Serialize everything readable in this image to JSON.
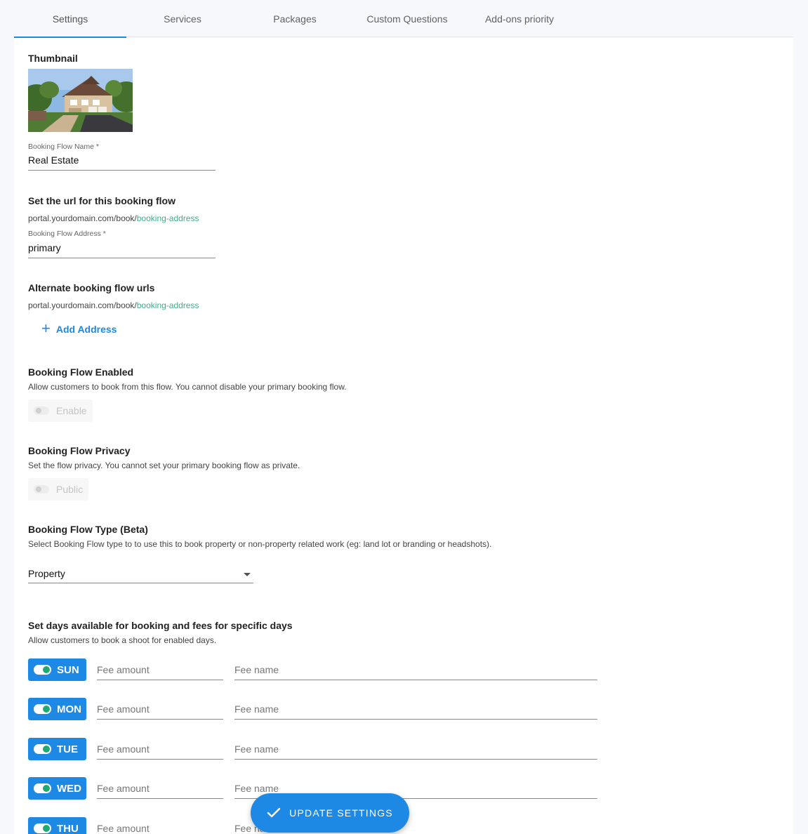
{
  "tabs": [
    {
      "label": "Settings"
    },
    {
      "label": "Services"
    },
    {
      "label": "Packages"
    },
    {
      "label": "Custom Questions"
    },
    {
      "label": "Add-ons priority"
    }
  ],
  "thumbnail": {
    "label": "Thumbnail"
  },
  "name_field": {
    "label": "Booking Flow Name *",
    "value": "Real Estate"
  },
  "url_section": {
    "heading": "Set the url for this booking flow",
    "base": "portal.yourdomain.com/book/",
    "slug": "booking-address",
    "field_label": "Booking Flow Address *",
    "field_value": "primary"
  },
  "alternate": {
    "heading": "Alternate booking flow urls",
    "base": "portal.yourdomain.com/book/",
    "slug": "booking-address",
    "add_label": "Add Address"
  },
  "enabled": {
    "heading": "Booking Flow Enabled",
    "description": "Allow customers to book from this flow. You cannot disable your primary booking flow.",
    "toggle_label": "Enable"
  },
  "privacy": {
    "heading": "Booking Flow Privacy",
    "description": "Set the flow privacy. You cannot set your primary booking flow as private.",
    "toggle_label": "Public"
  },
  "type": {
    "heading": "Booking Flow Type (Beta)",
    "description": "Select Booking Flow type to to use this to book property or non-property related work (eg: land lot or branding or headshots).",
    "selected": "Property"
  },
  "days": {
    "heading": "Set days available for booking and fees for specific days",
    "description": "Allow customers to book a shoot for enabled days.",
    "items": [
      {
        "day": "SUN",
        "fee_amount_placeholder": "Fee amount",
        "fee_name_placeholder": "Fee name"
      },
      {
        "day": "MON",
        "fee_amount_placeholder": "Fee amount",
        "fee_name_placeholder": "Fee name"
      },
      {
        "day": "TUE",
        "fee_amount_placeholder": "Fee amount",
        "fee_name_placeholder": "Fee name"
      },
      {
        "day": "WED",
        "fee_amount_placeholder": "Fee amount",
        "fee_name_placeholder": "Fee name"
      },
      {
        "day": "THU",
        "fee_amount_placeholder": "Fee amount",
        "fee_name_placeholder": "Fee name"
      }
    ]
  },
  "update_button": {
    "label": "UPDATE SETTINGS"
  },
  "colors": {
    "accent": "#1e88e5",
    "slug": "#3fae8c",
    "toggle_on": "#1eaa77"
  }
}
